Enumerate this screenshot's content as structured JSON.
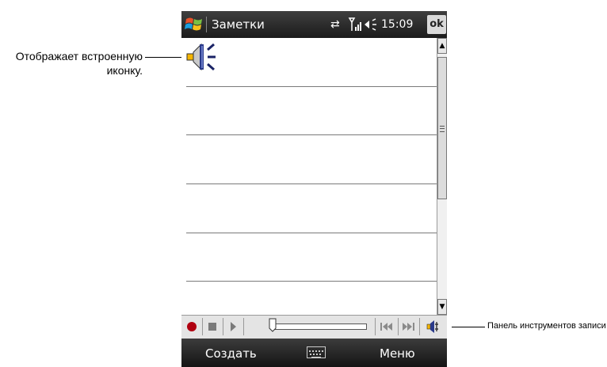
{
  "callouts": {
    "left": "Отображает встроенную иконку.",
    "right": "Панель инструментов записи"
  },
  "titlebar": {
    "app_title": "Заметки",
    "time": "15:09",
    "ok_label": "ok",
    "icons": [
      "windows-start-icon",
      "sync-arrows-icon",
      "signal-icon",
      "speaker-icon"
    ]
  },
  "note": {
    "embedded_icon": "speaker-sound-icon"
  },
  "scrollbar": {
    "icons": [
      "scroll-up-icon",
      "scroll-thumb-grip",
      "scroll-down-icon"
    ]
  },
  "record_toolbar": {
    "icons": [
      "record-icon",
      "stop-icon",
      "play-icon",
      "volume-slider",
      "previous-icon",
      "next-icon",
      "speaker-icon"
    ],
    "record_color": "#b00010"
  },
  "softkeys": {
    "left": "Создать",
    "right": "Меню",
    "center_icon": "keyboard-icon"
  }
}
